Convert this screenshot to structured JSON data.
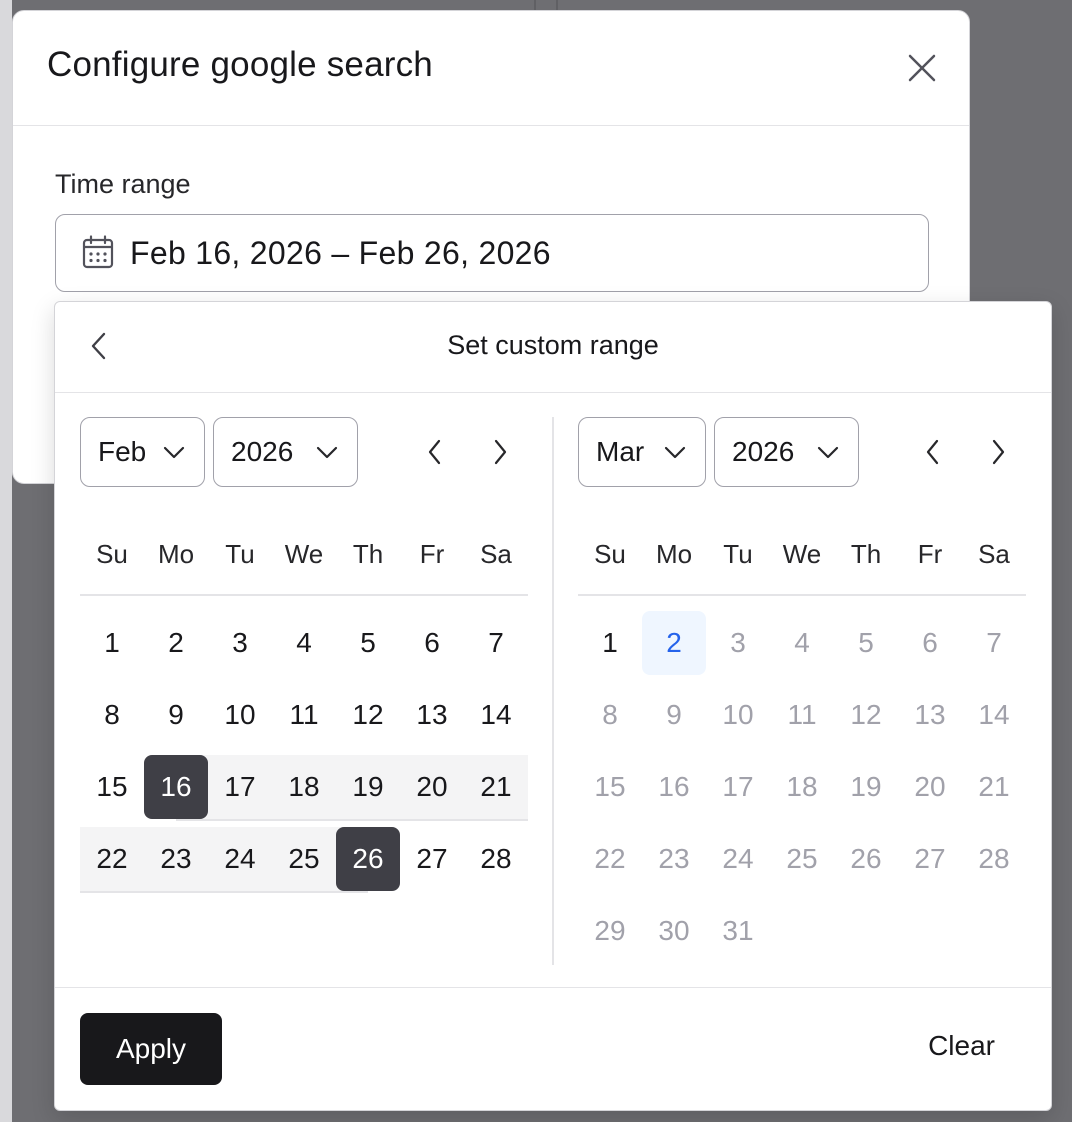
{
  "dialog": {
    "title": "Configure google search",
    "field_label": "Time range",
    "range_value": "Feb 16, 2026 – Feb 26, 2026"
  },
  "popover": {
    "title": "Set custom range",
    "weekdays": [
      "Su",
      "Mo",
      "Tu",
      "We",
      "Th",
      "Fr",
      "Sa"
    ],
    "left": {
      "month": "Feb",
      "year": "2026",
      "weeks": [
        [
          "1",
          "2",
          "3",
          "4",
          "5",
          "6",
          "7"
        ],
        [
          "8",
          "9",
          "10",
          "11",
          "12",
          "13",
          "14"
        ],
        [
          "15",
          "16",
          "17",
          "18",
          "19",
          "20",
          "21"
        ],
        [
          "22",
          "23",
          "24",
          "25",
          "26",
          "27",
          "28"
        ]
      ]
    },
    "right": {
      "month": "Mar",
      "year": "2026",
      "weeks": [
        [
          "1",
          "2",
          "3",
          "4",
          "5",
          "6",
          "7"
        ],
        [
          "8",
          "9",
          "10",
          "11",
          "12",
          "13",
          "14"
        ],
        [
          "15",
          "16",
          "17",
          "18",
          "19",
          "20",
          "21"
        ],
        [
          "22",
          "23",
          "24",
          "25",
          "26",
          "27",
          "28"
        ],
        [
          "29",
          "30",
          "31",
          "",
          "",
          "",
          ""
        ]
      ]
    },
    "apply_label": "Apply",
    "clear_label": "Clear"
  },
  "colors": {
    "selected_bg": "#3f3f46",
    "range_bg": "#f4f4f5",
    "today_bg": "#eff6ff",
    "today_text": "#2563eb",
    "muted_text": "#a1a1aa",
    "primary_button": "#18181b"
  },
  "icons": {
    "close": "close-icon",
    "calendar": "calendar-icon",
    "back": "chevron-left-icon",
    "prev": "chevron-left-icon",
    "next": "chevron-right-icon",
    "dropdown": "chevron-down-icon"
  }
}
